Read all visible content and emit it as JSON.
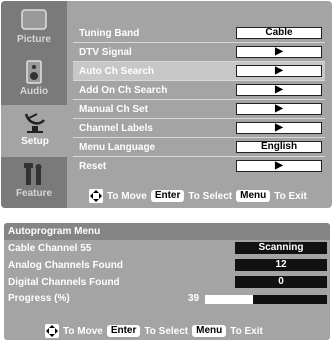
{
  "sidebar": {
    "items": [
      {
        "label": "Picture",
        "icon": "picture-icon"
      },
      {
        "label": "Audio",
        "icon": "speaker-icon"
      },
      {
        "label": "Setup",
        "icon": "satellite-dish-icon"
      },
      {
        "label": "Feature",
        "icon": "tools-icon"
      }
    ],
    "active": "Setup"
  },
  "setup_menu": {
    "rows": [
      {
        "label": "Tuning Band",
        "value": "Cable"
      },
      {
        "label": "DTV Signal",
        "value": "▶"
      },
      {
        "label": "Auto Ch Search",
        "value": "▶"
      },
      {
        "label": "Add On Ch Search",
        "value": "▶"
      },
      {
        "label": "Manual Ch Set",
        "value": "▶"
      },
      {
        "label": "Channel Labels",
        "value": "▶"
      },
      {
        "label": "Menu Language",
        "value": "English"
      },
      {
        "label": "Reset",
        "value": "▶"
      }
    ],
    "highlighted": "Auto Ch Search"
  },
  "hint": {
    "move": "To Move",
    "enter_key": "Enter",
    "select": "To Select",
    "menu_key": "Menu",
    "exit": "To Exit"
  },
  "autoprogram": {
    "title": "Autoprogram Menu",
    "cable_channel_label": "Cable Channel 55",
    "cable_channel_status": "Scanning",
    "analog_label": "Analog Channels Found",
    "analog_value": "12",
    "digital_label": "Digital Channels Found",
    "digital_value": "0",
    "progress_label": "Progress (%)",
    "progress_value": "39",
    "progress_percent": 39
  },
  "colors": {
    "panel_bg": "#a4a4a4",
    "sidebar_bg": "#7a7a7a",
    "highlight_bg": "#c7c7c7",
    "value_box_dark": "#111111"
  }
}
